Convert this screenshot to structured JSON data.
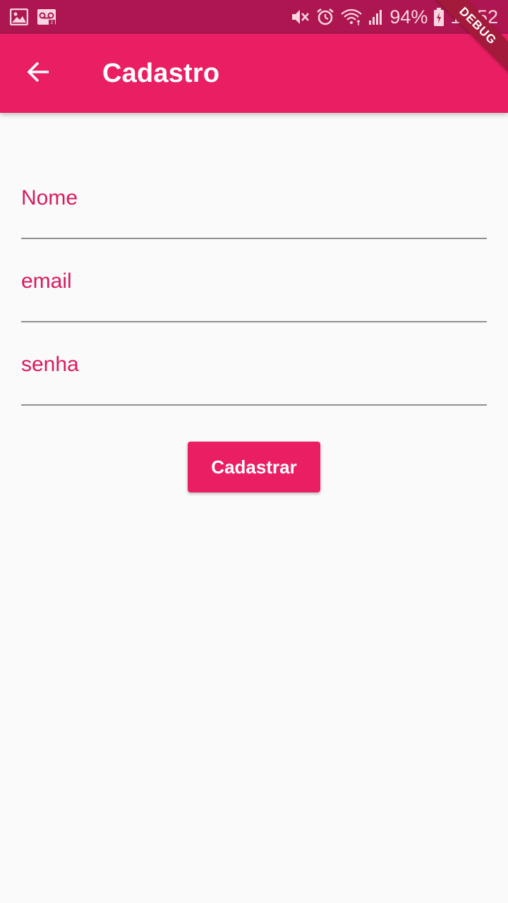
{
  "status_bar": {
    "battery_percent": "94%",
    "time": "16:52",
    "left_icons": [
      "image-icon",
      "voicemail-icon"
    ],
    "right_icons": [
      "mute-icon",
      "alarm-icon",
      "wifi-icon",
      "signal-icon",
      "battery-charging-icon"
    ]
  },
  "app_bar": {
    "title": "Cadastro",
    "back_icon": "arrow-back-icon",
    "debug_banner": "DEBUG"
  },
  "form": {
    "fields": [
      {
        "label": "Nome",
        "value": ""
      },
      {
        "label": "email",
        "value": ""
      },
      {
        "label": "senha",
        "value": ""
      }
    ],
    "submit_label": "Cadastrar"
  },
  "colors": {
    "primary": "#e91e63",
    "primary_dark": "#ad1650",
    "label": "#d81b60",
    "background": "#fafafa",
    "underline": "#8f8f8f"
  }
}
